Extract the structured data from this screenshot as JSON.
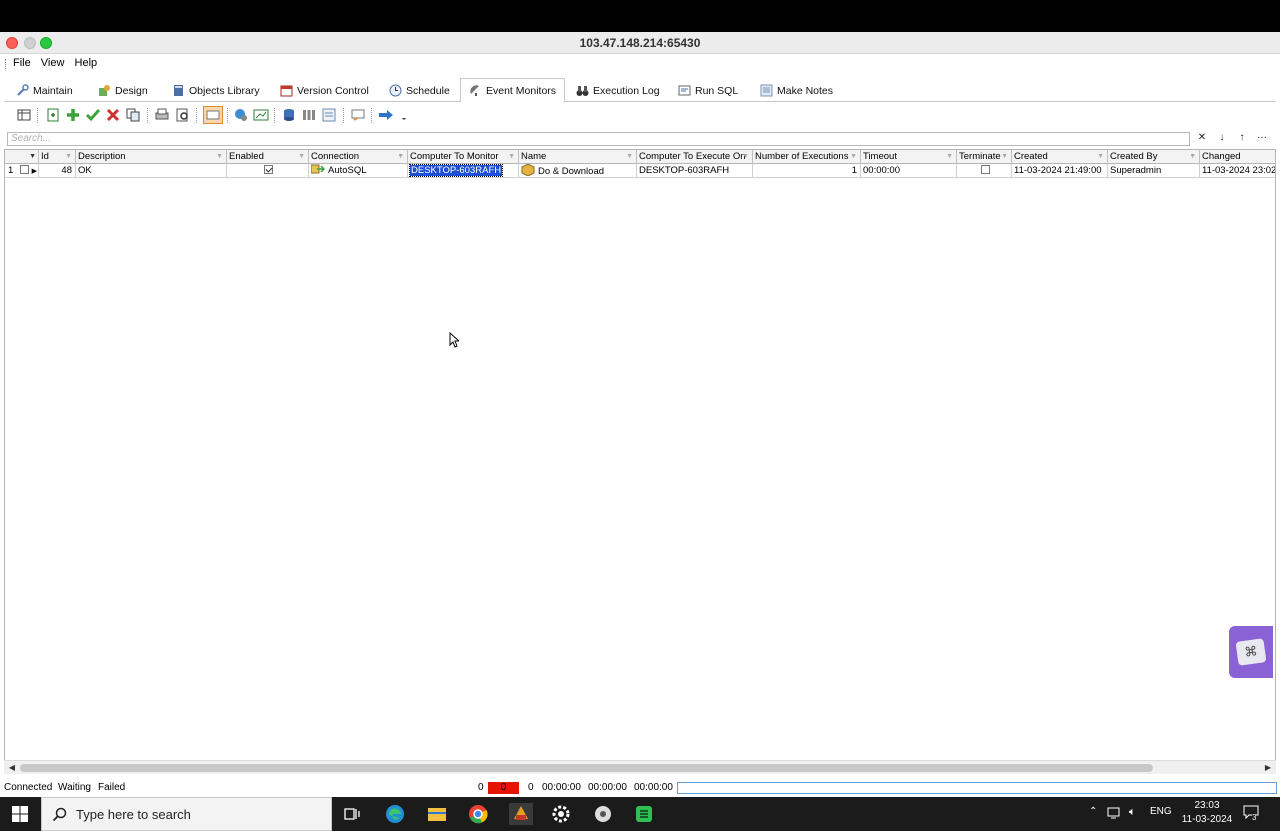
{
  "window": {
    "title": "103.47.148.214:65430"
  },
  "menu": {
    "items": [
      "File",
      "View",
      "Help"
    ]
  },
  "tabs": [
    {
      "label": "Maintain",
      "icon": "wrench-icon"
    },
    {
      "label": "Design",
      "icon": "puzzle-icon"
    },
    {
      "label": "Objects Library",
      "icon": "book-icon"
    },
    {
      "label": "Version Control",
      "icon": "calendar-icon"
    },
    {
      "label": "Schedule",
      "icon": "clock-icon"
    },
    {
      "label": "Event Monitors",
      "icon": "satellite-icon",
      "active": true
    },
    {
      "label": "Execution Log",
      "icon": "binoculars-icon"
    },
    {
      "label": "Run SQL",
      "icon": "sql-icon"
    },
    {
      "label": "Make Notes",
      "icon": "notes-icon"
    }
  ],
  "search": {
    "placeholder": "Search..."
  },
  "grid": {
    "columns": [
      "Id",
      "Description",
      "Enabled",
      "Connection",
      "Computer To Monitor",
      "Name",
      "Computer To Execute On",
      "Number of Executions",
      "Timeout",
      "Terminate",
      "Created",
      "Created By",
      "Changed"
    ],
    "rows": [
      {
        "row_number": "1",
        "id": "48",
        "description": "OK",
        "enabled": true,
        "connection": "AutoSQL",
        "computer_to_monitor": "DESKTOP-603RAFH",
        "name": "Do & Download",
        "computer_to_execute_on": "DESKTOP-603RAFH",
        "number_of_executions": "1",
        "timeout": "00:00:00",
        "terminate": false,
        "created": "11-03-2024 21:49:00",
        "created_by": "Superadmin",
        "changed": "11-03-2024 23:02"
      }
    ]
  },
  "status": {
    "connected": "Connected",
    "waiting": "Waiting",
    "failed": "Failed",
    "count_left": "0",
    "count_red": "0",
    "count_right": "0",
    "time1": "00:00:00",
    "time2": "00:00:00",
    "time3": "00:00:00"
  },
  "taskbar": {
    "search_placeholder": "Type here to search",
    "language": "ENG",
    "time": "23:03",
    "date": "11-03-2024",
    "notification_count": "3"
  },
  "colors": {
    "selection": "#1c4fd6",
    "failed_box": "#e51400",
    "taskbar": "#1b1b1b"
  }
}
